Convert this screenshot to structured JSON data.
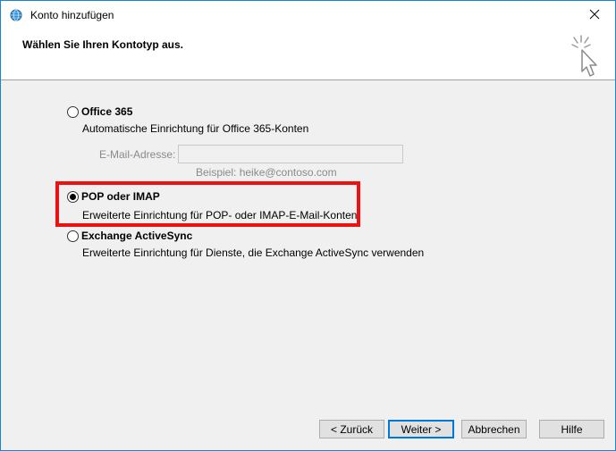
{
  "window": {
    "title": "Konto hinzufügen",
    "accent_color": "#1883d7"
  },
  "header": {
    "title": "Wählen Sie Ihren Kontotyp aus."
  },
  "options": [
    {
      "label": "Office 365",
      "description": "Automatische Einrichtung für Office 365-Konten",
      "selected": false
    },
    {
      "label": "POP oder IMAP",
      "description": "Erweiterte Einrichtung für POP- oder IMAP-E-Mail-Konten",
      "selected": true
    },
    {
      "label": "Exchange ActiveSync",
      "description": "Erweiterte Einrichtung für Dienste, die Exchange ActiveSync verwenden",
      "selected": false
    }
  ],
  "email": {
    "label": "E-Mail-Adresse:",
    "value": "",
    "example": "Beispiel: heike@contoso.com"
  },
  "highlight_color": "#ee1111",
  "buttons": {
    "back": "< Zurück",
    "next": "Weiter >",
    "cancel": "Abbrechen",
    "help": "Hilfe"
  },
  "icons": {
    "title": "globe-icon",
    "close": "close-icon",
    "wizard": "wizard-cursor-icon"
  }
}
